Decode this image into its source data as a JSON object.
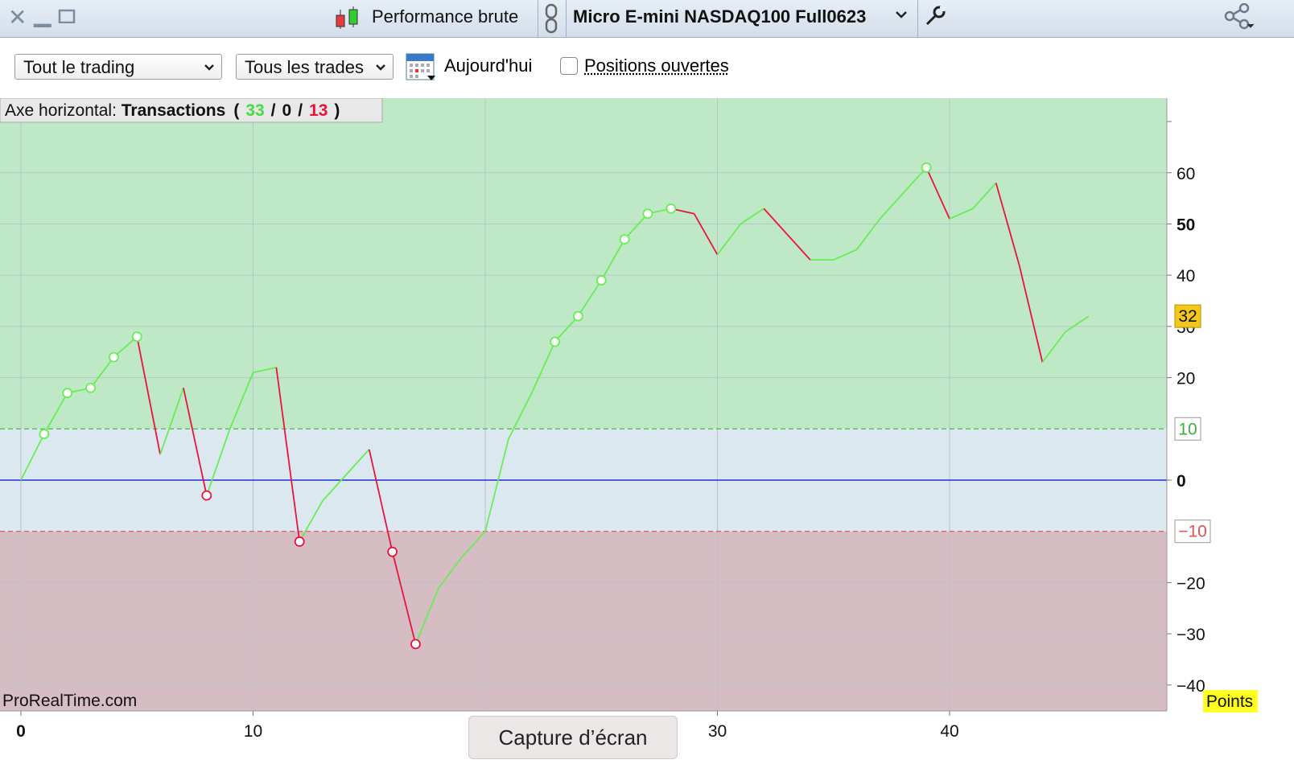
{
  "titlebar": {
    "mode_label": "Performance brute",
    "instrument_label": "Micro E-mini NASDAQ100 Full0623",
    "icons": [
      "close-icon",
      "minimize-icon",
      "maximize-icon",
      "candlestick-icon",
      "link-icon",
      "chevron-down-icon",
      "wrench-icon",
      "share-icon"
    ]
  },
  "toolbar": {
    "scope_select": "Tout le trading",
    "trades_select": "Tous les trades",
    "today_label": "Aujourd'hui",
    "open_positions_label": "Positions ouvertes",
    "open_positions_checked": false
  },
  "info": {
    "prefix": "Axe horizontal: ",
    "axis_name": "Transactions",
    "open_paren": "(",
    "winning": "33",
    "slash": "/",
    "neutral": "0",
    "losing": "13",
    "close_paren": ")",
    "win_color": "#44dd44",
    "loss_color": "#e8143c"
  },
  "watermark": "ProRealTime.com",
  "units_label": "Points",
  "tooltip": "Capture d’écran",
  "chart_data": {
    "type": "line",
    "x": [
      0,
      1,
      2,
      3,
      4,
      5,
      6,
      7,
      8,
      9,
      10,
      11,
      12,
      13,
      14,
      15,
      16,
      17,
      18,
      19,
      20,
      21,
      22,
      23,
      24,
      25,
      26,
      27,
      28,
      29,
      30,
      31,
      32,
      33,
      34,
      35,
      36,
      37,
      38,
      39,
      40,
      41,
      42,
      43,
      44,
      45,
      46
    ],
    "y": [
      0,
      9,
      17,
      18,
      24,
      28,
      5,
      18,
      -3,
      10,
      21,
      22,
      -12,
      -4,
      1,
      6,
      -14,
      -32,
      -21,
      -15,
      -10,
      8,
      17,
      27,
      32,
      39,
      47,
      52,
      53,
      52,
      44,
      50,
      53,
      48,
      43,
      43,
      45,
      51,
      56,
      61,
      51,
      53,
      58,
      42,
      23,
      29,
      32
    ],
    "marked_points": [
      1,
      2,
      3,
      4,
      5,
      8,
      12,
      16,
      17,
      23,
      24,
      25,
      26,
      27,
      28,
      39
    ],
    "xlim": [
      0,
      49
    ],
    "ylim": [
      -45,
      70
    ],
    "x_ticks": [
      "0",
      "10",
      "30",
      "40"
    ],
    "y_ticks": [
      "60",
      "50",
      "40",
      "30",
      "20",
      "0",
      "-20",
      "-30",
      "-40"
    ],
    "upper_threshold": 10,
    "lower_threshold": -10,
    "upper_label": "10",
    "lower_label": "-10",
    "zero_line": 0,
    "last_value_label": "32",
    "grid": true,
    "rising_color": "#66ee55",
    "falling_color": "#e8143c",
    "zone_colors": {
      "profit": "#bfe8c6",
      "neutral": "#dce8ef",
      "loss": "#d6bcc3"
    }
  }
}
